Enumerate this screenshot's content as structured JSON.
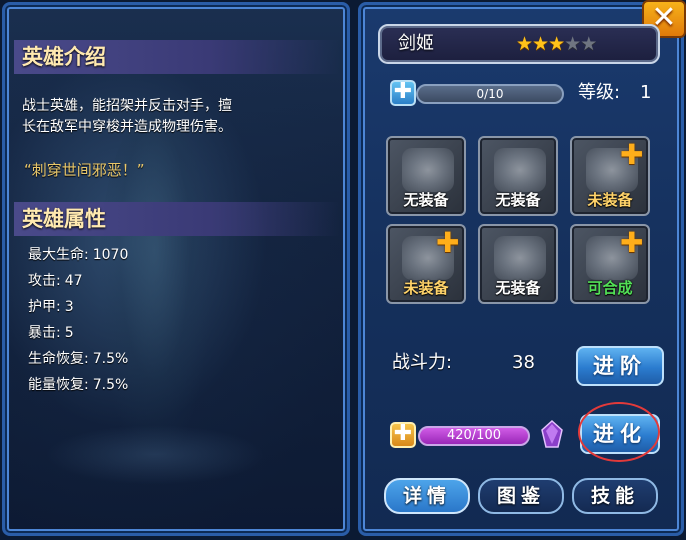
{
  "intro": {
    "header": "英雄介绍",
    "description_line1": "战士英雄，能招架并反击对手，擅",
    "description_line2": "长在敌军中穿梭并造成物理伤害。",
    "quote": "“刺穿世间邪恶！”"
  },
  "attributes": {
    "header": "英雄属性",
    "items": [
      {
        "label": "最大生命:",
        "value": "1070"
      },
      {
        "label": "攻击:",
        "value": "47"
      },
      {
        "label": "护甲:",
        "value": "3"
      },
      {
        "label": "暴击:",
        "value": "5"
      },
      {
        "label": "生命恢复:",
        "value": "7.5%"
      },
      {
        "label": "能量恢复:",
        "value": "7.5%"
      }
    ]
  },
  "hero": {
    "name": "剑姬",
    "stars_filled": 3,
    "stars_total": 5,
    "star_glyphs": [
      "★",
      "★",
      "★",
      "★",
      "★"
    ],
    "level_label": "等级:",
    "level_value": "1",
    "exp_text": "0/10"
  },
  "close_glyph": "✕",
  "plus_glyph": "✚",
  "equipment": [
    {
      "label": "无装备",
      "icon": "scroll-icon",
      "state": "empty"
    },
    {
      "label": "无装备",
      "icon": "blade-icon",
      "state": "empty"
    },
    {
      "label": "未装备",
      "icon": "armor-icon",
      "state": "unequipped"
    },
    {
      "label": "未装备",
      "icon": "gauntlet-icon",
      "state": "unequipped"
    },
    {
      "label": "无装备",
      "icon": "boot-icon",
      "state": "empty"
    },
    {
      "label": "可合成",
      "icon": "helmet-icon",
      "state": "synthesizable"
    }
  ],
  "power": {
    "label": "战斗力:",
    "value": "38"
  },
  "advance_button": "进阶",
  "evolve": {
    "progress_text": "420/100",
    "button": "进化"
  },
  "tabs": [
    {
      "label": "详情",
      "active": true
    },
    {
      "label": "图鉴",
      "active": false
    },
    {
      "label": "技能",
      "active": false
    }
  ],
  "colors": {
    "panel_border": "#2a5da8",
    "header_text": "#ffe9b0",
    "quote_text": "#e9c76a",
    "star_on": "#ffc21a",
    "star_off": "#6f7581",
    "close_bg": "#f0961a",
    "purple_bar": "#b33fd0",
    "synth_text": "#52e056",
    "highlight_circle": "#e23a3a"
  }
}
